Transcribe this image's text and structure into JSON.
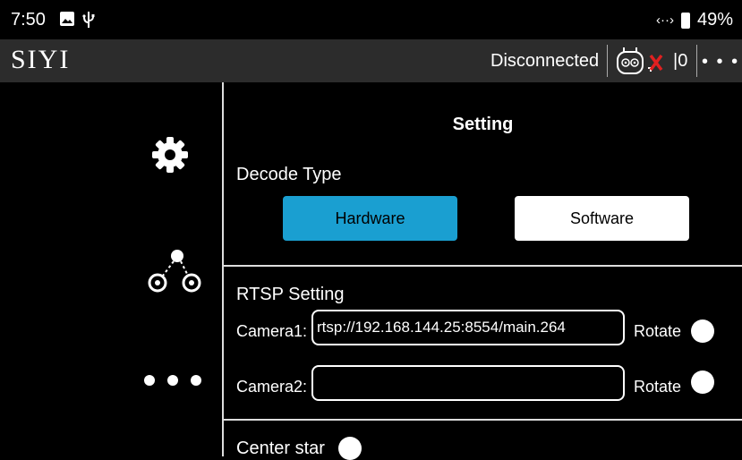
{
  "status_bar": {
    "time": "7:50",
    "battery": "49%",
    "icons": [
      "image-icon",
      "usb-icon",
      "signal-arrows-icon",
      "battery-icon"
    ]
  },
  "titlebar": {
    "logo": "SIYI",
    "connection_status": "Disconnected",
    "rc_count": "|0",
    "menu": "• • •",
    "icons": [
      "remote-controller-icon",
      "red-x-icon",
      "more-icon"
    ]
  },
  "sidebar": {
    "items": [
      {
        "name": "settings",
        "icon": "gear-icon"
      },
      {
        "name": "network",
        "icon": "network-nodes-icon"
      },
      {
        "name": "more",
        "icon": "more-dots-icon"
      }
    ]
  },
  "setting": {
    "title": "Setting",
    "decode_type": {
      "label": "Decode Type",
      "options": [
        "Hardware",
        "Software"
      ],
      "selected": "Hardware"
    },
    "rtsp": {
      "label": "RTSP Setting",
      "camera1_label": "Camera1:",
      "camera1_value": "rtsp://192.168.144.25:8554/main.264",
      "camera2_label": "Camera2:",
      "camera2_value": "",
      "rotate_label": "Rotate"
    },
    "center_star_label": "Center star"
  },
  "colors": {
    "accent": "#1a9fd1",
    "titlebar_bg": "#2c2c2c",
    "background": "#000000",
    "error": "#e02020"
  }
}
